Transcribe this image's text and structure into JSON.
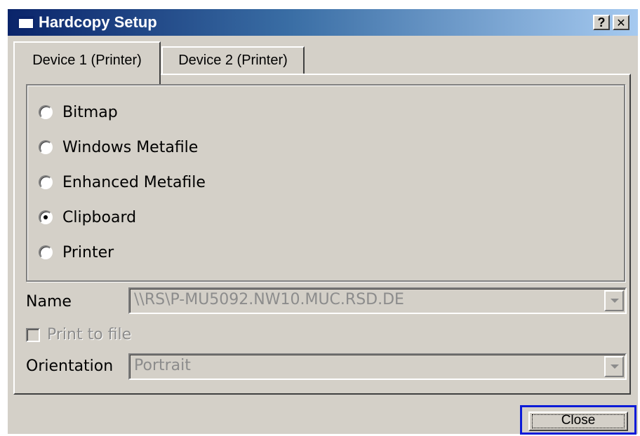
{
  "window": {
    "title": "Hardcopy Setup",
    "help_label": "?",
    "close_label": "✕"
  },
  "tabs": [
    {
      "label": "Device 1 (Printer)",
      "active": true
    },
    {
      "label": "Device 2 (Printer)",
      "active": false
    }
  ],
  "format_options": [
    {
      "label": "Bitmap",
      "checked": false
    },
    {
      "label": "Windows Metafile",
      "checked": false
    },
    {
      "label": "Enhanced Metafile",
      "checked": false
    },
    {
      "label": "Clipboard",
      "checked": true
    },
    {
      "label": "Printer",
      "checked": false
    }
  ],
  "name": {
    "label": "Name",
    "value": "\\\\RS\\P-MU5092.NW10.MUC.RSD.DE"
  },
  "print_to_file": {
    "label": "Print to file",
    "checked": false
  },
  "orientation": {
    "label": "Orientation",
    "value": "Portrait"
  },
  "buttons": {
    "close_label": "Close"
  },
  "colors": {
    "title_gradient_start": "#0a246a",
    "title_gradient_end": "#a6caf0",
    "dialog_face": "#d4d0c8",
    "focus_border": "#0b1bd8",
    "disabled_text": "#8c8c8c"
  }
}
